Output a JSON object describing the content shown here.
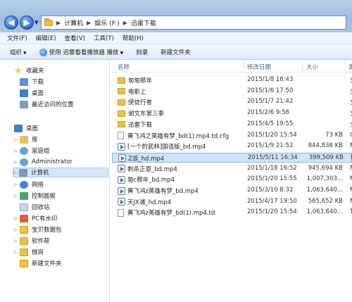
{
  "address": {
    "crumbs": [
      "计算机",
      "娱乐 (F:)",
      "迅雷下载"
    ],
    "separator": "▶"
  },
  "menu": [
    "文件(F)",
    "编辑(E)",
    "查看(V)",
    "工具(T)",
    "帮助(H)"
  ],
  "toolbar": {
    "organize": "组织",
    "play_with": "使用 迅雷看看播放器 播放",
    "burn": "刻录",
    "new_folder": "新建文件夹"
  },
  "sidebar": {
    "favorites": "收藏夹",
    "fav_items": [
      "下载",
      "桌面",
      "最近访问的位置"
    ],
    "desktop": "桌面",
    "desktop_items": [
      "库",
      "家庭组",
      "Administrator",
      "计算机",
      "网络",
      "控制面板",
      "回收站",
      "PC有水印",
      "宝贝数据包",
      "软件帮",
      "微商",
      "新建文件夹"
    ]
  },
  "columns": {
    "name": "名称",
    "date": "修改日期",
    "size": "大小",
    "type": "类"
  },
  "files": [
    {
      "name": "匆匆那年",
      "date": "2015/1/8 16:43",
      "size": "",
      "type": "文",
      "kind": "folder"
    },
    {
      "name": "电影上",
      "date": "2015/1/6 17:50",
      "size": "",
      "type": "文",
      "kind": "folder"
    },
    {
      "name": "使徒行者",
      "date": "2015/1/7 21:42",
      "size": "",
      "type": "文",
      "kind": "folder"
    },
    {
      "name": "谢文东第三季",
      "date": "2015/2/6 9:58",
      "size": "",
      "type": "文",
      "kind": "folder"
    },
    {
      "name": "迅雷下载",
      "date": "2015/4/5 19:55",
      "size": "",
      "type": "文",
      "kind": "folder"
    },
    {
      "name": "黄飞鸿之英雄有梦_bd(1).mp4.td.cfg",
      "date": "2015/1/20 15:54",
      "size": "73 KB",
      "type": "C",
      "kind": "doc"
    },
    {
      "name": "[一个的武林]国语版_bd.mp4",
      "date": "2015/1/9 21:52",
      "size": "844,836 KB",
      "type": "M",
      "kind": "media"
    },
    {
      "name": "Z浪_hd.mp4",
      "date": "2015/5/11 16:34",
      "size": "399,509 KB",
      "type": "M",
      "kind": "media",
      "selected": true
    },
    {
      "name": "刺杀正恩_bd.mp4",
      "date": "2015/1/18 16:52",
      "size": "945,694 KB",
      "type": "M",
      "kind": "media"
    },
    {
      "name": "匆c那年_bd.mp4",
      "date": "2015/1/20 15:55",
      "size": "1,007,303...",
      "type": "M",
      "kind": "media"
    },
    {
      "name": "黄飞鸿z英雄有梦_bd.mp4",
      "date": "2015/3/10 8:32",
      "size": "1,063,640...",
      "type": "M",
      "kind": "media"
    },
    {
      "name": "天JX浦_hd.mp4",
      "date": "2015/4/17 19:50",
      "size": "565,652 KB",
      "type": "M",
      "kind": "media"
    },
    {
      "name": "黄飞鸿z英雄有梦_bd(1).mp4.td",
      "date": "2015/1/20 15:54",
      "size": "1,063,640...",
      "type": "T",
      "kind": "doc"
    }
  ]
}
